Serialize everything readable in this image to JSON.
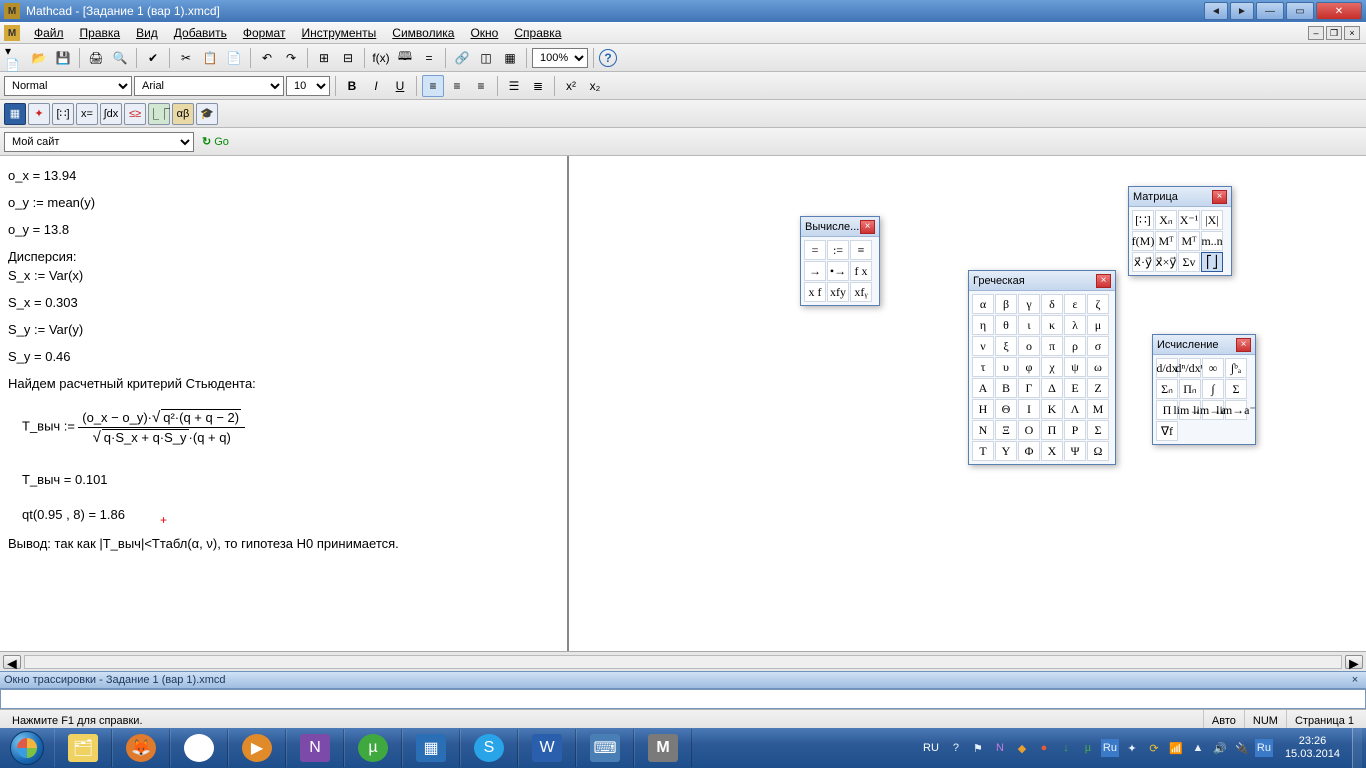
{
  "window": {
    "title": "Mathcad - [Задание 1 (вар 1).xmcd]"
  },
  "menu": [
    "Файл",
    "Правка",
    "Вид",
    "Добавить",
    "Формат",
    "Инструменты",
    "Символика",
    "Окно",
    "Справка"
  ],
  "format_toolbar": {
    "style": "Normal",
    "font": "Arial",
    "size": "10",
    "zoom": "100%"
  },
  "sitebar": {
    "label": "Мой сайт",
    "go": "Go"
  },
  "doc": {
    "line1": "o_x = 13.94",
    "line2": "o_y := mean(y)",
    "line3": "o_y = 13.8",
    "h1": "Дисперсия:",
    "line4": "S_x := Var(x)",
    "line5": "S_x = 0.303",
    "line6": "S_y := Var(y)",
    "line7": "S_y = 0.46",
    "h2": "Найдем расчетный критерий Стьюдента:",
    "formula_lhs": "T_выч :=",
    "formula_num_a": "(o_x − o_y)·",
    "formula_num_sqrt": "q²·(q + q − 2)",
    "formula_den_sqrt": "q·S_x + q·S_y",
    "formula_den_tail": "·(q + q)",
    "line8": "T_выч = 0.101",
    "line9": "qt(0.95 , 8) = 1.86",
    "line10": "Вывод: так как |T_выч|<Tтабл(α, ν), то гипотеза H0 принимается."
  },
  "trace": {
    "title": "Окно трассировки - Задание 1 (вар 1).xmcd"
  },
  "status": {
    "help": "Нажмите F1 для справки.",
    "auto": "Авто",
    "num": "NUM",
    "page": "Страница 1"
  },
  "palette_eval": {
    "title": "Вычисле...",
    "cells": [
      "=",
      ":=",
      "≡",
      "→",
      "•→",
      "f x",
      "x f",
      "xfy",
      "xfᵧ"
    ]
  },
  "palette_greek": {
    "title": "Греческая",
    "rows": [
      [
        "α",
        "β",
        "γ",
        "δ",
        "ε",
        "ζ"
      ],
      [
        "η",
        "θ",
        "ι",
        "κ",
        "λ",
        "μ"
      ],
      [
        "ν",
        "ξ",
        "ο",
        "π",
        "ρ",
        "σ"
      ],
      [
        "τ",
        "υ",
        "φ",
        "χ",
        "ψ",
        "ω"
      ],
      [
        "Α",
        "Β",
        "Γ",
        "Δ",
        "Ε",
        "Ζ"
      ],
      [
        "Η",
        "Θ",
        "Ι",
        "Κ",
        "Λ",
        "Μ"
      ],
      [
        "Ν",
        "Ξ",
        "Ο",
        "Π",
        "Ρ",
        "Σ"
      ],
      [
        "Τ",
        "Υ",
        "Φ",
        "Χ",
        "Ψ",
        "Ω"
      ]
    ]
  },
  "palette_matrix": {
    "title": "Матрица",
    "rows": [
      [
        "[∷]",
        "Xₙ",
        "X⁻¹",
        "|X|"
      ],
      [
        "f(M)",
        "Mᵀ",
        "Mᵀ",
        "m..n"
      ],
      [
        "x⃗·y⃗",
        "x⃗×y⃗",
        "Σv",
        "⎡⎦"
      ]
    ]
  },
  "palette_calc": {
    "title": "Исчисление",
    "rows": [
      [
        "d/dx",
        "dⁿ/dxⁿ",
        "∞",
        "∫ᵇₐ"
      ],
      [
        "Σₙ",
        "Πₙ",
        "∫",
        "Σ"
      ],
      [
        "Π",
        "lim→a",
        "lim→a⁺",
        "lim→a⁻"
      ],
      [
        "∇f",
        "",
        "",
        ""
      ]
    ]
  },
  "taskbar": {
    "lang": "RU",
    "time": "23:26",
    "date": "15.03.2014"
  }
}
